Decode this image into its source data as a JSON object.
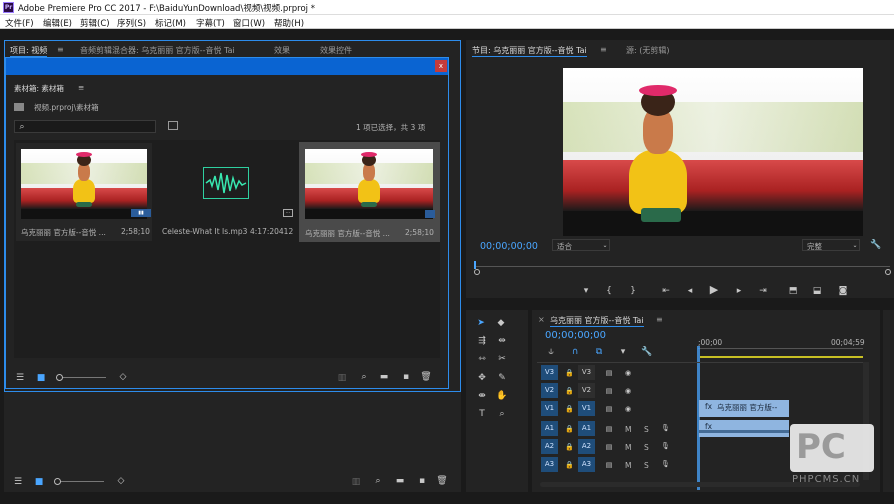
{
  "window": {
    "title": "Adobe Premiere Pro CC 2017 - F:\\BaiduYunDownload\\视频\\视频.prproj *",
    "app_icon": "Pr"
  },
  "menu": [
    "文件(F)",
    "编辑(E)",
    "剪辑(C)",
    "序列(S)",
    "标记(M)",
    "字幕(T)",
    "窗口(W)",
    "帮助(H)"
  ],
  "project_panel": {
    "tabs": [
      "项目: 视频",
      "音频剪辑混合器: 乌克丽丽 官方版--音悦 Tai",
      "效果",
      "效果控件"
    ],
    "bin_title": "素材箱: 素材箱",
    "path": "视频.prproj\\素材箱",
    "selection": "1 项已选择，共 3 项",
    "close_label": "x",
    "items": [
      {
        "name": "乌克丽丽 官方版--音悦 ...",
        "duration": "2;58;10"
      },
      {
        "name": "Celeste-What It Is.mp3",
        "duration": "4:17:20412"
      },
      {
        "name": "乌克丽丽 官方版--音悦 ...",
        "duration": "2;58;10"
      }
    ]
  },
  "program_monitor": {
    "tab": "节目: 乌克丽丽 官方版--音悦 Tai",
    "source": "源: (无剪辑)",
    "timecode": "00;00;00;00",
    "fit": "适合",
    "quality": "完整"
  },
  "timeline": {
    "tab": "乌克丽丽 官方版--音悦 Tai",
    "timecode": "00;00;00;00",
    "ruler_start": ";00;00",
    "ruler_end": "00;04;59",
    "video_tracks": [
      "V3",
      "V2",
      "V1"
    ],
    "audio_tracks": [
      "A1",
      "A2",
      "A3"
    ],
    "clip_label": "乌克丽丽 官方版--",
    "m_label": "M",
    "s_label": "S",
    "fx_label": "fx"
  },
  "watermark": {
    "text": "PHPCMS.CN",
    "logo": "PC"
  },
  "colors": {
    "accent": "#2d8ceb",
    "selection": "#0a64d2",
    "timecode": "#4aa6ff",
    "clip": "#8fb5e0"
  }
}
